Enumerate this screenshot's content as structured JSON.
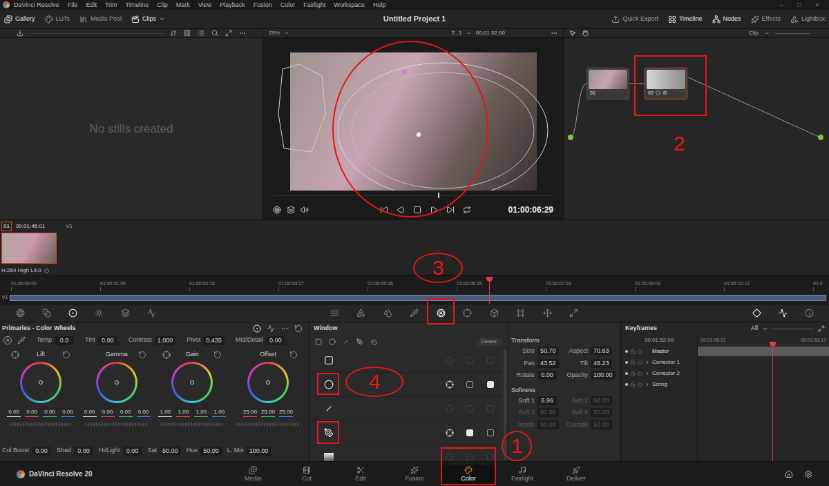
{
  "app_bar": {
    "app_name": "DaVinci Resolve",
    "menu": [
      "File",
      "Edit",
      "Trim",
      "Timeline",
      "Clip",
      "Mark",
      "View",
      "Playback",
      "Fusion",
      "Color",
      "Fairlight",
      "Workspace",
      "Help"
    ],
    "window_controls": [
      "–",
      "□",
      "×"
    ]
  },
  "top_toolbar": {
    "left": [
      {
        "label": "Gallery",
        "selected": true
      },
      {
        "label": "LUTs",
        "selected": false
      },
      {
        "label": "Media Pool",
        "selected": false
      },
      {
        "label": "Clips",
        "selected": true
      }
    ],
    "title": "Untitled Project 1",
    "right": [
      {
        "label": "Quick Export",
        "selected": false
      },
      {
        "label": "Timeline",
        "selected": true
      },
      {
        "label": "Nodes",
        "selected": true
      },
      {
        "label": "Effects",
        "selected": false
      },
      {
        "label": "Lightbox",
        "selected": false
      }
    ]
  },
  "viewer_bar": {
    "zoom": "29%",
    "timeline": "T...1",
    "timecode": "00:01:52:00",
    "node_mode": "Clip"
  },
  "gallery": {
    "empty_text": "No stills created"
  },
  "viewer": {
    "timecode": "01:00:06:29",
    "scrub_level": 0.59
  },
  "nodes": [
    {
      "label": "01",
      "selected": false
    },
    {
      "label": "02",
      "selected": true
    }
  ],
  "clips": [
    {
      "index": "01",
      "timecode": "00:01:45:01",
      "track": "V1",
      "codec": "H.264 High L4.0",
      "selected": true
    }
  ],
  "mini_timeline": {
    "ticks": [
      "01:00:00:00",
      "01:00:01:09",
      "01:00:02:18",
      "01:00:03:27",
      "01:00:05:06",
      "01:00:06:15",
      "01:00:07:24",
      "01:00:09:03",
      "01:00:10:12",
      "01:0"
    ],
    "track": "V1",
    "playhead_level": 0.59
  },
  "palette": {
    "left": [
      {
        "selected": false
      },
      {
        "selected": false
      },
      {
        "selected": true
      },
      {
        "selected": false
      },
      {
        "selected": false
      },
      {
        "selected": false
      }
    ],
    "middle": [
      {
        "selected": false
      },
      {
        "selected": false
      },
      {
        "selected": false
      },
      {
        "selected": false
      },
      {
        "selected": true
      },
      {
        "selected": false
      },
      {
        "selected": false
      },
      {
        "selected": false
      },
      {
        "selected": false
      },
      {
        "selected": false
      }
    ],
    "right": [
      {
        "selected": true
      },
      {
        "selected": true
      },
      {
        "selected": false
      }
    ]
  },
  "primaries": {
    "title": "Primaries - Color Wheels",
    "auto_label": "A",
    "top_controls": [
      {
        "label": "Temp",
        "value": "0.0"
      },
      {
        "label": "Tint",
        "value": "0.00"
      },
      {
        "label": "Contrast",
        "value": "1.000"
      },
      {
        "label": "Pivot",
        "value": "0.435"
      },
      {
        "label": "Mid/Detail",
        "value": "0.00"
      }
    ],
    "wheels": [
      {
        "label": "Lift",
        "values": [
          "0.00",
          "0.00",
          "0.00",
          "0.00"
        ]
      },
      {
        "label": "Gamma",
        "values": [
          "0.00",
          "0.00",
          "0.00",
          "0.00"
        ]
      },
      {
        "label": "Gain",
        "values": [
          "1.00",
          "1.00",
          "1.00",
          "1.00"
        ]
      },
      {
        "label": "Offset",
        "values": [
          "25.00",
          "25.00",
          "25.00"
        ]
      }
    ],
    "bottom_controls": [
      {
        "label": "Col Boost",
        "value": "0.00"
      },
      {
        "label": "Shad",
        "value": "0.00"
      },
      {
        "label": "Hi/Light",
        "value": "0.00"
      },
      {
        "label": "Sat",
        "value": "50.00"
      },
      {
        "label": "Hue",
        "value": "50.00"
      },
      {
        "label": "L. Mix",
        "value": "100.00"
      }
    ]
  },
  "window_panel": {
    "title": "Window",
    "delete_label": "Delete",
    "shapes": [
      {
        "kind": "square",
        "active": false,
        "invert": false,
        "mask": false
      },
      {
        "kind": "circle",
        "active": true,
        "invert": false,
        "mask": true
      },
      {
        "kind": "line",
        "active": false,
        "invert": false,
        "mask": false
      },
      {
        "kind": "pen",
        "active": true,
        "invert": true,
        "mask": false
      },
      {
        "kind": "gradient",
        "active": false,
        "invert": false,
        "mask": false
      }
    ]
  },
  "transform": {
    "title": "Transform",
    "fields": [
      {
        "label": "Size",
        "value": "50.70",
        "disabled": false
      },
      {
        "label": "Aspect",
        "value": "70.63",
        "disabled": false
      },
      {
        "label": "Pan",
        "value": "43.52",
        "disabled": false
      },
      {
        "label": "Tilt",
        "value": "48.23",
        "disabled": false
      },
      {
        "label": "Rotate",
        "value": "0.00",
        "disabled": false
      },
      {
        "label": "Opacity",
        "value": "100.00",
        "disabled": false
      }
    ]
  },
  "softness": {
    "title": "Softness",
    "fields": [
      {
        "label": "Soft 1",
        "value": "6.96",
        "disabled": false
      },
      {
        "label": "Soft 2",
        "value": "50.00",
        "disabled": true
      },
      {
        "label": "Soft 3",
        "value": "50.00",
        "disabled": true
      },
      {
        "label": "Soft 4",
        "value": "50.00",
        "disabled": true
      },
      {
        "label": "Inside",
        "value": "50.00",
        "disabled": true
      },
      {
        "label": "Outside",
        "value": "50.00",
        "disabled": true
      }
    ]
  },
  "keyframes": {
    "title": "Keyframes",
    "filter": "All",
    "timecode": "00:01:52:00",
    "ruler": [
      "00:01:45:01",
      "00:01:53:17"
    ],
    "playhead_level": 0.57,
    "tracks": [
      {
        "label": "Master",
        "kind": "master",
        "expanded": false
      },
      {
        "label": "Corrector 1",
        "kind": "node",
        "expanded": false
      },
      {
        "label": "Corrector 2",
        "kind": "node",
        "expanded": false
      },
      {
        "label": "Sizing",
        "kind": "node",
        "expanded": false
      }
    ]
  },
  "pages": [
    {
      "label": "Media",
      "selected": false
    },
    {
      "label": "Cut",
      "selected": false
    },
    {
      "label": "Edit",
      "selected": false
    },
    {
      "label": "Fusion",
      "selected": false
    },
    {
      "label": "Color",
      "selected": true
    },
    {
      "label": "Fairlight",
      "selected": false
    },
    {
      "label": "Deliver",
      "selected": false
    }
  ],
  "version_label": "DaVinci Resolve 20",
  "annotations": [
    {
      "label": "1"
    },
    {
      "label": "2"
    },
    {
      "label": "3"
    },
    {
      "label": "4"
    }
  ]
}
